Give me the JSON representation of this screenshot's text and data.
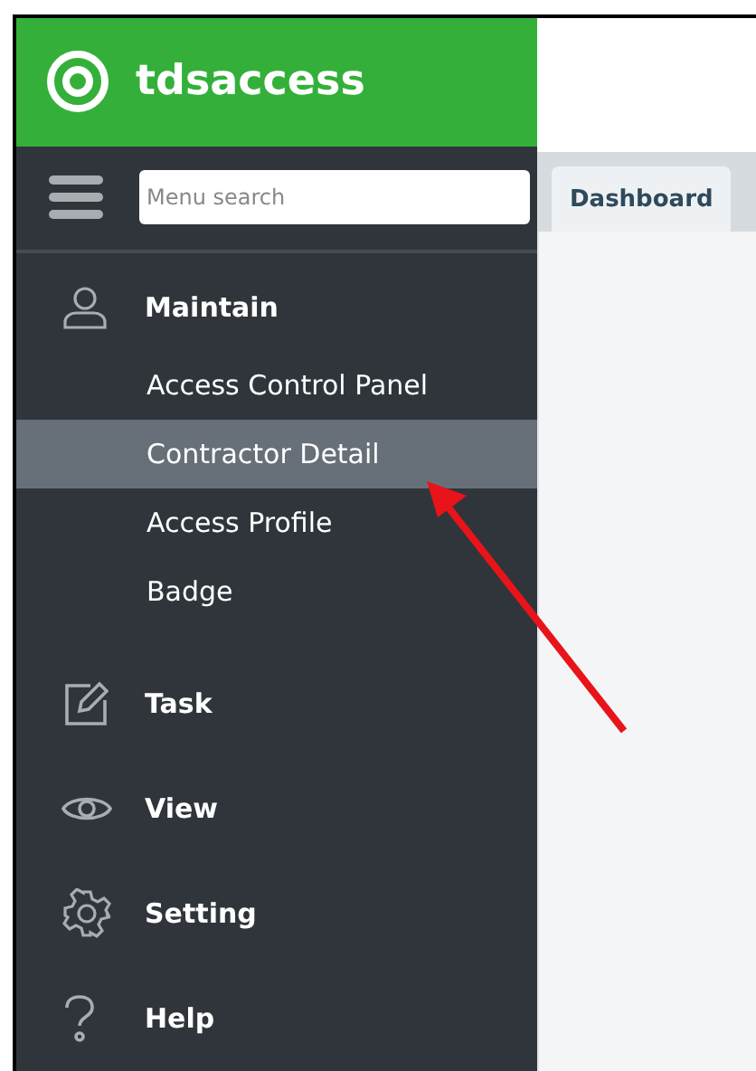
{
  "brand": {
    "name": "tdsaccess"
  },
  "menu_search": {
    "placeholder": "Menu search"
  },
  "tabs": [
    {
      "label": "Dashboard",
      "selected": true
    }
  ],
  "sidebar": {
    "items": [
      {
        "label": "Maintain",
        "children": [
          {
            "label": "Access Control Panel",
            "selected": false
          },
          {
            "label": "Contractor Detail",
            "selected": true
          },
          {
            "label": "Access Profile",
            "selected": false
          },
          {
            "label": "Badge",
            "selected": false
          }
        ]
      },
      {
        "label": "Task"
      },
      {
        "label": "View"
      },
      {
        "label": "Setting"
      },
      {
        "label": "Help"
      }
    ]
  }
}
